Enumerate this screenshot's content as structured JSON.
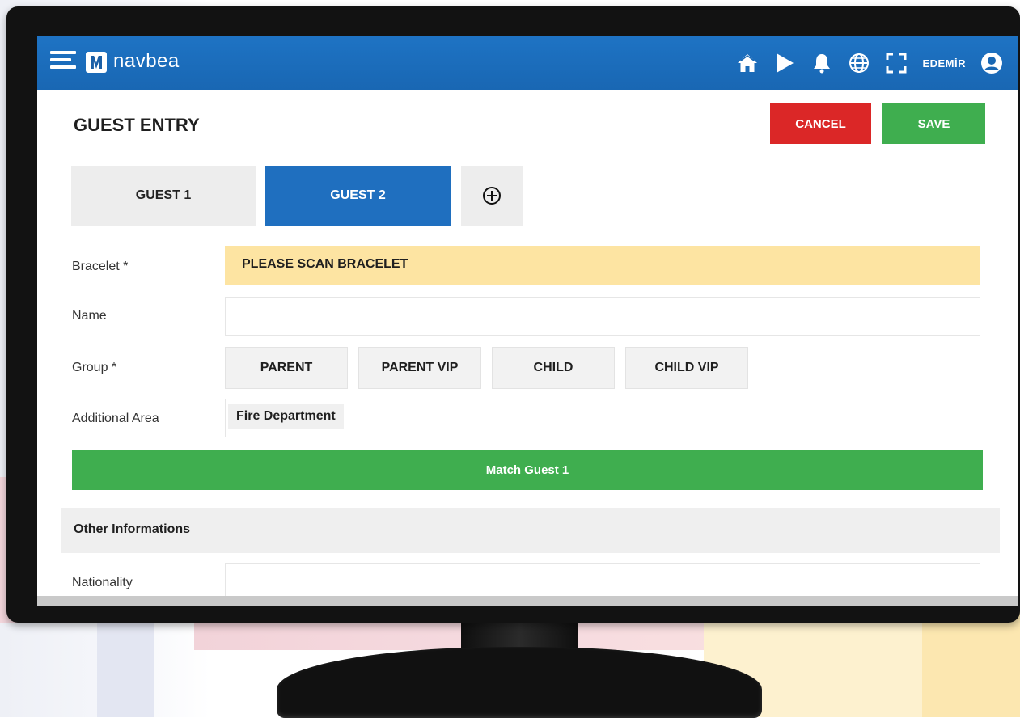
{
  "app": {
    "logo_text": "navbea",
    "user": "EDEMİR"
  },
  "topbar_icons": [
    "menu-icon",
    "home-icon",
    "play-icon",
    "bell-icon",
    "globe-icon",
    "fullscreen-icon",
    "user-icon"
  ],
  "page": {
    "title": "GUEST ENTRY",
    "cancel_label": "CANCEL",
    "save_label": "SAVE"
  },
  "tabs": [
    {
      "label": "GUEST 1",
      "active": false
    },
    {
      "label": "GUEST 2",
      "active": true
    }
  ],
  "form": {
    "bracelet_label": "Bracelet *",
    "bracelet_value": "PLEASE SCAN BRACELET",
    "name_label": "Name",
    "name_value": "",
    "group_label": "Group *",
    "group_options": [
      "PARENT",
      "PARENT VIP",
      "CHILD",
      "CHILD VIP"
    ],
    "area_label": "Additional Area",
    "area_value": "Fire Department",
    "match_label": "Match Guest 1"
  },
  "other": {
    "section_title": "Other Informations",
    "nationality_label": "Nationality",
    "nationality_value": ""
  },
  "colors": {
    "primary": "#1f6fbf",
    "cancel": "#db2727",
    "save": "#3fae4f",
    "bracelet_bg": "#fde4a2"
  }
}
